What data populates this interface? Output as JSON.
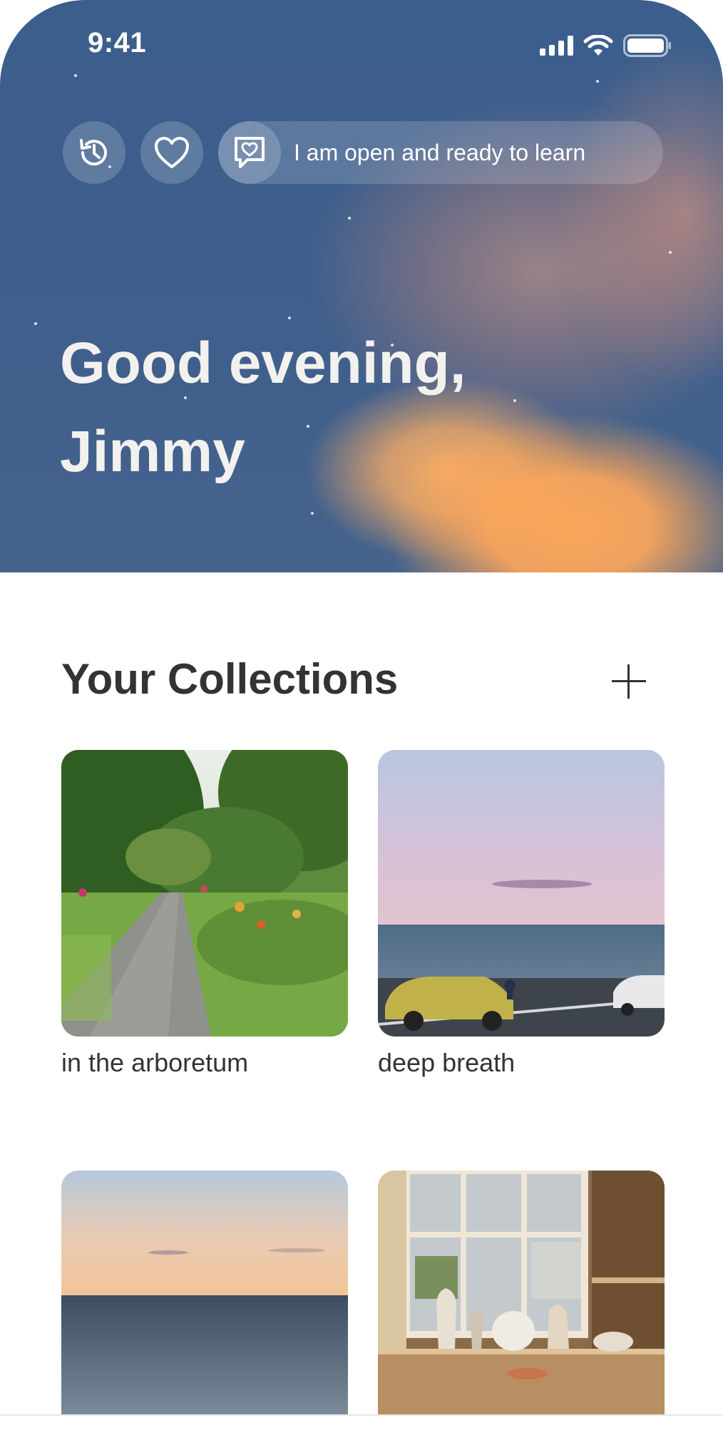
{
  "status_bar": {
    "time": "9:41"
  },
  "top_actions": {
    "history_icon": "history-icon",
    "favorites_icon": "heart-icon",
    "affirmation_icon": "message-heart-icon",
    "affirmation_text": "I am open and ready to learn"
  },
  "greeting": {
    "line1": "Good evening,",
    "line2": "Jimmy"
  },
  "collections": {
    "title": "Your Collections",
    "add_icon": "plus-icon",
    "items": [
      {
        "label": "in the arboretum"
      },
      {
        "label": "deep breath"
      },
      {
        "label": ""
      },
      {
        "label": ""
      }
    ]
  }
}
